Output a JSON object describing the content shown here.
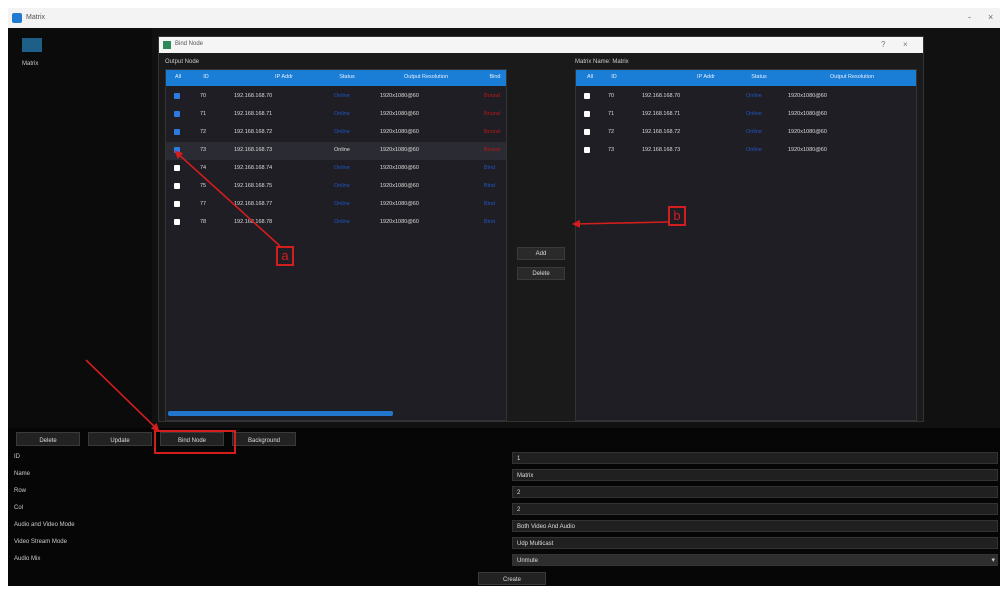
{
  "window": {
    "title": "Matrix",
    "minimize": "-",
    "close": "×"
  },
  "left_panel": {
    "thumb_label": "Matrix"
  },
  "dialog": {
    "title": "Bind Node",
    "help": "?",
    "close": "×"
  },
  "output_table": {
    "label": "Output Node",
    "headers": [
      "All",
      "ID",
      "IP Addr",
      "Status",
      "Output Resolution",
      "Bind"
    ],
    "rows": [
      {
        "checked": true,
        "id": "70",
        "ip": "192.168.168.70",
        "status": "Online",
        "res": "1920x1080@60",
        "bind": "Bound"
      },
      {
        "checked": true,
        "id": "71",
        "ip": "192.168.168.71",
        "status": "Online",
        "res": "1920x1080@60",
        "bind": "Bound"
      },
      {
        "checked": true,
        "id": "72",
        "ip": "192.168.168.72",
        "status": "Online",
        "res": "1920x1080@60",
        "bind": "Bound"
      },
      {
        "checked": true,
        "id": "73",
        "ip": "192.168.168.73",
        "status": "Online",
        "res": "1920x1080@60",
        "bind": "Bound"
      },
      {
        "checked": false,
        "id": "74",
        "ip": "192.168.168.74",
        "status": "Online",
        "res": "1920x1080@60",
        "bind": "Bind"
      },
      {
        "checked": false,
        "id": "75",
        "ip": "192.168.168.75",
        "status": "Online",
        "res": "1920x1080@60",
        "bind": "Bind"
      },
      {
        "checked": false,
        "id": "77",
        "ip": "192.168.168.77",
        "status": "Online",
        "res": "1920x1080@60",
        "bind": "Bind"
      },
      {
        "checked": false,
        "id": "78",
        "ip": "192.168.168.78",
        "status": "Online",
        "res": "1920x1080@60",
        "bind": "Bind"
      }
    ]
  },
  "matrix_table": {
    "label": "Matrix Name: Matrix",
    "headers": [
      "All",
      "ID",
      "IP Addr",
      "Status",
      "Output Resolution"
    ],
    "rows": [
      {
        "id": "70",
        "ip": "192.168.168.70",
        "status": "Online",
        "res": "1920x1080@60"
      },
      {
        "id": "71",
        "ip": "192.168.168.71",
        "status": "Online",
        "res": "1920x1080@60"
      },
      {
        "id": "72",
        "ip": "192.168.168.72",
        "status": "Online",
        "res": "1920x1080@60"
      },
      {
        "id": "73",
        "ip": "192.168.168.73",
        "status": "Online",
        "res": "1920x1080@60"
      }
    ]
  },
  "middle_buttons": {
    "add": "Add",
    "delete": "Delete"
  },
  "bottom_buttons": {
    "delete": "Delete",
    "update": "Update",
    "bind_node": "Bind Node",
    "background": "Background"
  },
  "form": {
    "id_label": "ID",
    "id_value": "1",
    "name_label": "Name",
    "name_value": "Matrix",
    "row_label": "Row",
    "row_value": "2",
    "col_label": "Col",
    "col_value": "2",
    "av_mode_label": "Audio and Video Mode",
    "av_mode_value": "Both Video And Audio",
    "stream_mode_label": "Video Stream Mode",
    "stream_mode_value": "Udp Multicast",
    "audio_mix_label": "Audio Mix",
    "audio_mix_value": "Unmute"
  },
  "create_button": "Create",
  "annotations": {
    "a": "a",
    "b": "b"
  },
  "colors": {
    "accent": "#1a7dd6",
    "annotation": "#d41d1d",
    "status_online": "#2256c4",
    "bound": "#c01818"
  }
}
